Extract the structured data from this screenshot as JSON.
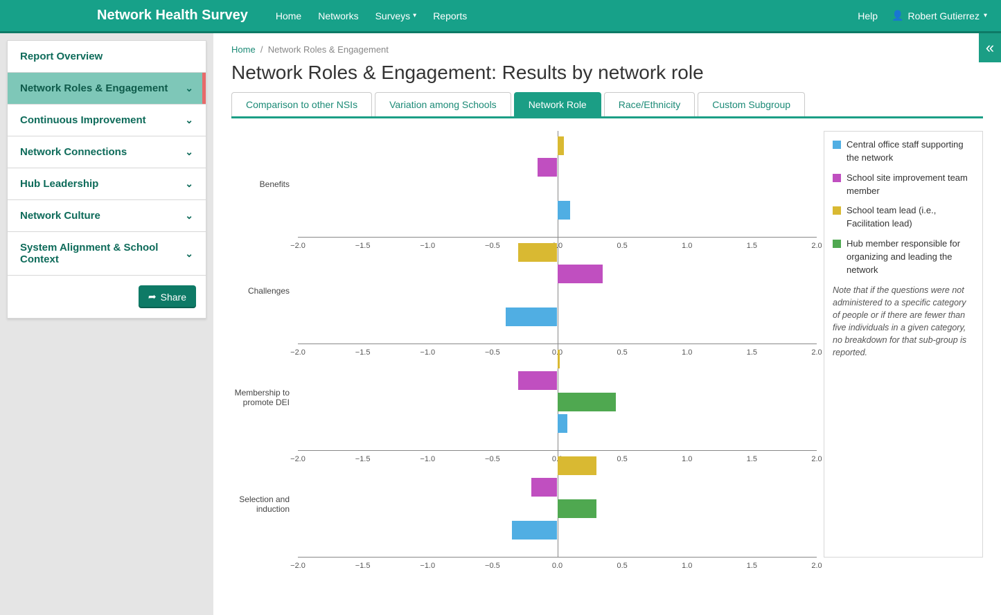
{
  "header": {
    "brand": "Network Health Survey",
    "nav": {
      "home": "Home",
      "networks": "Networks",
      "surveys": "Surveys",
      "reports": "Reports"
    },
    "help": "Help",
    "user": "Robert Gutierrez"
  },
  "sidebar": {
    "items": [
      {
        "label": "Report Overview",
        "expandable": false
      },
      {
        "label": "Network Roles & Engagement",
        "expandable": true,
        "active": true
      },
      {
        "label": "Continuous Improvement",
        "expandable": true
      },
      {
        "label": "Network Connections",
        "expandable": true
      },
      {
        "label": "Hub Leadership",
        "expandable": true
      },
      {
        "label": "Network Culture",
        "expandable": true
      },
      {
        "label": "System Alignment & School Context",
        "expandable": true
      }
    ],
    "share": "Share"
  },
  "breadcrumb": {
    "home": "Home",
    "current": "Network Roles & Engagement"
  },
  "page_title": "Network Roles & Engagement: Results by network role",
  "tabs": [
    {
      "label": "Comparison to other NSIs"
    },
    {
      "label": "Variation among Schools"
    },
    {
      "label": "Network Role",
      "active": true
    },
    {
      "label": "Race/Ethnicity"
    },
    {
      "label": "Custom Subgroup"
    }
  ],
  "legend": {
    "items": [
      {
        "color": "#50aee3",
        "label": "Central office staff supporting the network"
      },
      {
        "color": "#c04fc0",
        "label": "School site improvement team member"
      },
      {
        "color": "#d9b932",
        "label": "School team lead (i.e., Facilitation lead)"
      },
      {
        "color": "#4fa850",
        "label": "Hub member responsible for organizing and leading the network"
      }
    ],
    "note": "Note that if the questions were not administered to a specific category of people or if there are fewer than five individuals in a given category, no breakdown for that sub-group is reported."
  },
  "chart_data": {
    "type": "bar",
    "orientation": "horizontal",
    "xlim": [
      -2.0,
      2.0
    ],
    "xticks": [
      -2.0,
      -1.5,
      -1.0,
      -0.5,
      0.0,
      0.5,
      1.0,
      1.5,
      2.0
    ],
    "xtick_labels": [
      "−2.0",
      "−1.5",
      "−1.0",
      "−0.5",
      "0.0",
      "0.5",
      "1.0",
      "1.5",
      "2.0"
    ],
    "series": [
      {
        "name": "School team lead (i.e., Facilitation lead)",
        "color": "#d9b932",
        "key": "gold"
      },
      {
        "name": "School site improvement team member",
        "color": "#c04fc0",
        "key": "purple"
      },
      {
        "name": "Hub member responsible for organizing and leading the network",
        "color": "#4fa850",
        "key": "green"
      },
      {
        "name": "Central office staff supporting the network",
        "color": "#50aee3",
        "key": "blue"
      }
    ],
    "panels": [
      {
        "label": "Benefits",
        "values": {
          "gold": 0.05,
          "purple": -0.15,
          "green": null,
          "blue": 0.1
        }
      },
      {
        "label": "Challenges",
        "values": {
          "gold": -0.3,
          "purple": 0.35,
          "green": null,
          "blue": -0.4
        }
      },
      {
        "label": "Membership to promote DEI",
        "values": {
          "gold": 0.02,
          "purple": -0.3,
          "green": 0.45,
          "blue": 0.08
        }
      },
      {
        "label": "Selection and induction",
        "values": {
          "gold": 0.3,
          "purple": -0.2,
          "green": 0.3,
          "blue": -0.35
        }
      }
    ]
  }
}
